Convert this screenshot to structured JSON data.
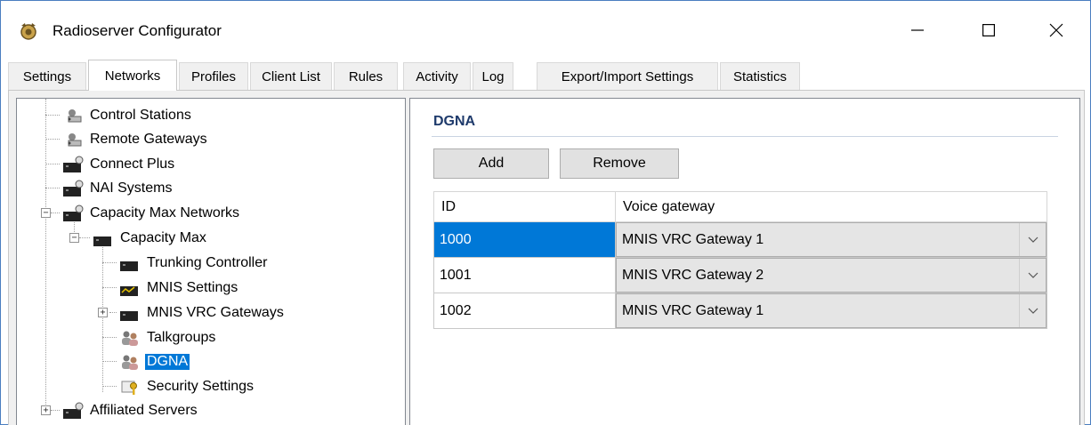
{
  "window": {
    "title": "Radioserver Configurator",
    "accent": "#0078d7"
  },
  "tabs": [
    {
      "label": "Settings"
    },
    {
      "label": "Networks",
      "active": true
    },
    {
      "label": "Profiles"
    },
    {
      "label": "Client List"
    },
    {
      "label": "Rules"
    },
    {
      "label": "Activity"
    },
    {
      "label": "Log"
    },
    {
      "label": "Export/Import Settings"
    },
    {
      "label": "Statistics"
    }
  ],
  "tree": {
    "items": [
      {
        "label": "Control Stations",
        "icon": "radio-station-icon"
      },
      {
        "label": "Remote Gateways",
        "icon": "radio-station-icon"
      },
      {
        "label": "Connect Plus",
        "icon": "server-icon"
      },
      {
        "label": "NAI Systems",
        "icon": "server-icon"
      },
      {
        "label": "Capacity Max Networks",
        "icon": "server-icon",
        "expander": "minus"
      },
      {
        "label": "Capacity Max",
        "icon": "server-icon",
        "expander": "minus"
      },
      {
        "label": "Trunking Controller",
        "icon": "server-icon"
      },
      {
        "label": "MNIS Settings",
        "icon": "mnis-settings-icon"
      },
      {
        "label": "MNIS VRC Gateways",
        "icon": "server-icon",
        "expander": "plus"
      },
      {
        "label": "Talkgroups",
        "icon": "group-icon"
      },
      {
        "label": "DGNA",
        "icon": "group-icon",
        "selected": true
      },
      {
        "label": "Security Settings",
        "icon": "key-icon"
      },
      {
        "label": "Affiliated Servers",
        "icon": "server-icon",
        "expander": "plus"
      }
    ]
  },
  "dgna": {
    "title": "DGNA",
    "add_label": "Add",
    "remove_label": "Remove",
    "columns": [
      "ID",
      "Voice gateway"
    ],
    "rows": [
      {
        "id": "1000",
        "gateway": "MNIS VRC Gateway 1",
        "selected": true
      },
      {
        "id": "1001",
        "gateway": "MNIS VRC Gateway 2"
      },
      {
        "id": "1002",
        "gateway": "MNIS VRC Gateway 1"
      }
    ]
  }
}
